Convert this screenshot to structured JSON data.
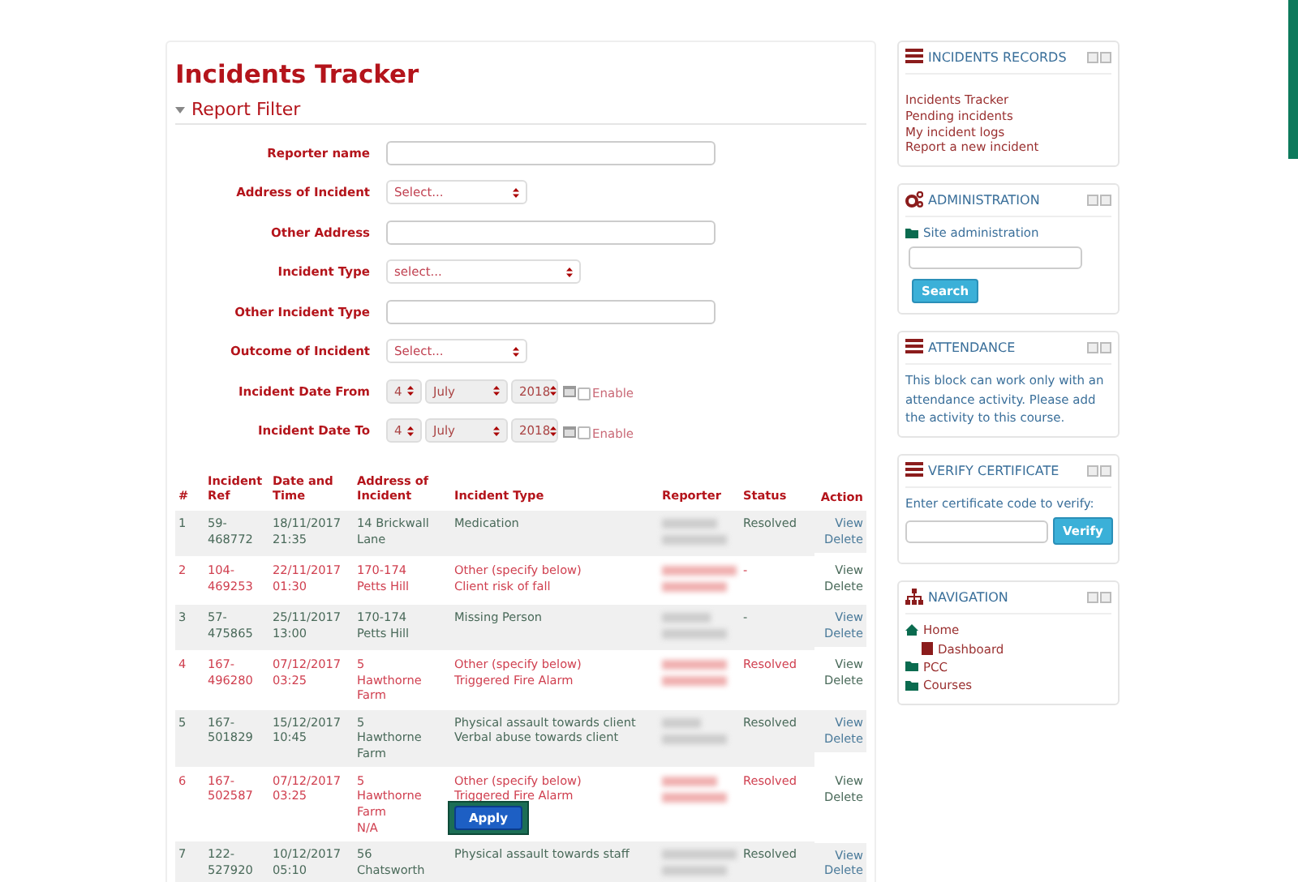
{
  "page_title": "Incidents Tracker",
  "filter": {
    "title": "Report Filter",
    "expanded": true,
    "fields": [
      {
        "kind": "text",
        "label": "Reporter name"
      },
      {
        "kind": "select",
        "label": "Address of Incident",
        "value": "Select..."
      },
      {
        "kind": "text",
        "label": "Other Address"
      },
      {
        "kind": "select",
        "label": "Incident Type",
        "value": "select..."
      },
      {
        "kind": "text",
        "label": "Other Incident Type"
      },
      {
        "kind": "select",
        "label": "Outcome of Incident",
        "value": "Select..."
      },
      {
        "kind": "date",
        "label": "Incident Date From",
        "day": "4",
        "month": "July",
        "year": "2018",
        "enable_label": "Enable",
        "enabled": false
      },
      {
        "kind": "date",
        "label": "Incident Date To",
        "day": "4",
        "month": "July",
        "year": "2018",
        "enable_label": "Enable",
        "enabled": false
      }
    ]
  },
  "table": {
    "columns": [
      "#",
      "Incident Ref",
      "Date and Time",
      "Address of Incident",
      "Incident Type",
      "Reporter",
      "Status",
      "Action"
    ],
    "rows": [
      {
        "num": "1",
        "ref": [
          "59-",
          "468772"
        ],
        "date": [
          "18/11/2017",
          "21:35"
        ],
        "address": [
          "14 Brickwall",
          "Lane"
        ],
        "type": [
          "Medication"
        ],
        "status": "Resolved",
        "flagged": false,
        "actions": [
          "View",
          "Delete"
        ]
      },
      {
        "num": "2",
        "ref": [
          "104-",
          "469253"
        ],
        "date": [
          "22/11/2017",
          "01:30"
        ],
        "address": [
          "170-174",
          "Petts Hill"
        ],
        "type": [
          "Other (specify below)",
          "Client risk of fall"
        ],
        "status": "-",
        "flagged": true,
        "actions": [
          "View",
          "Delete"
        ]
      },
      {
        "num": "3",
        "ref": [
          "57-",
          "475865"
        ],
        "date": [
          "25/11/2017",
          "13:00"
        ],
        "address": [
          "170-174",
          "Petts Hill"
        ],
        "type": [
          "Missing Person"
        ],
        "status": "-",
        "flagged": false,
        "actions": [
          "View",
          "Delete"
        ]
      },
      {
        "num": "4",
        "ref": [
          "167-",
          "496280"
        ],
        "date": [
          "07/12/2017",
          "03:25"
        ],
        "address": [
          "5",
          "Hawthorne",
          "Farm"
        ],
        "type": [
          "Other (specify below)",
          "Triggered Fire Alarm"
        ],
        "status": "Resolved",
        "flagged": true,
        "actions": [
          "View",
          "Delete"
        ]
      },
      {
        "num": "5",
        "ref": [
          "167-",
          "501829"
        ],
        "date": [
          "15/12/2017",
          "10:45"
        ],
        "address": [
          "5",
          "Hawthorne",
          "Farm"
        ],
        "type": [
          "Physical assault towards client",
          "Verbal abuse towards client"
        ],
        "status": "Resolved",
        "flagged": false,
        "actions": [
          "View",
          "Delete"
        ]
      },
      {
        "num": "6",
        "ref": [
          "167-",
          "502587"
        ],
        "date": [
          "07/12/2017",
          "03:25"
        ],
        "address": [
          "5",
          "Hawthorne",
          "Farm",
          "N/A"
        ],
        "type": [
          "Other (specify below)",
          "Triggered Fire Alarm"
        ],
        "status": "Resolved",
        "flagged": true,
        "actions": [
          "View",
          "Delete"
        ]
      },
      {
        "num": "7",
        "ref": [
          "122-",
          "527920"
        ],
        "date": [
          "10/12/2017",
          "05:10"
        ],
        "address": [
          "56",
          "Chatsworth"
        ],
        "type": [
          "Physical assault towards staff"
        ],
        "status": "Resolved",
        "flagged": false,
        "actions": [
          "View",
          "Delete"
        ]
      }
    ]
  },
  "apply_button": "Apply",
  "sidebar": [
    {
      "kind": "links",
      "title": "INCIDENTS RECORDS",
      "links": [
        "Incidents Tracker",
        "Pending incidents",
        "My incident logs",
        "Report a new incident"
      ]
    },
    {
      "kind": "admin",
      "title": "ADMINISTRATION",
      "link": "Site administration",
      "button": "Search"
    },
    {
      "kind": "text",
      "title": "ATTENDANCE",
      "text": "This block can work only with an attendance activity. Please add the activity to this course."
    },
    {
      "kind": "verify",
      "title": "VERIFY CERTIFICATE",
      "text": "Enter certificate code to verify:",
      "button": "Verify"
    },
    {
      "kind": "nav",
      "title": "NAVIGATION",
      "items": [
        {
          "label": "Home",
          "children": [
            {
              "label": "Dashboard"
            }
          ]
        },
        {
          "label": "PCC"
        },
        {
          "label": "Courses"
        }
      ]
    }
  ]
}
